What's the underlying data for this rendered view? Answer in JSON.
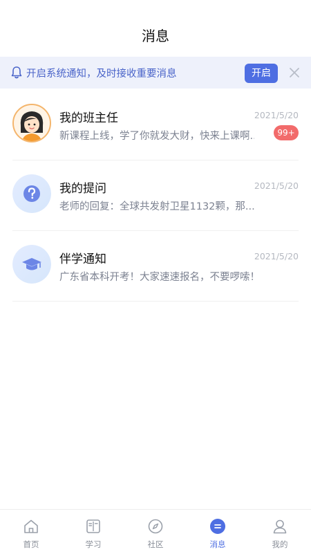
{
  "header": {
    "title": "消息"
  },
  "notice": {
    "text": "开启系统通知，及时接收重要消息",
    "button_label": "开启"
  },
  "messages": [
    {
      "name": "我的班主任",
      "date": "2021/5/20",
      "preview": "新课程上线，学了你就发大财，快来上课啊..",
      "badge": "99+",
      "avatar": "teacher-avatar"
    },
    {
      "name": "我的提问",
      "date": "2021/5/20",
      "preview": "老师的回复：全球共发射卫星1132颗，那...",
      "avatar": "question-icon"
    },
    {
      "name": "伴学通知",
      "date": "2021/5/20",
      "preview": "广东省本科开考！大家速速报名，不要啰嗦！",
      "avatar": "graduation-cap-icon"
    }
  ],
  "tabbar": {
    "items": [
      {
        "label": "首页",
        "icon": "home-icon"
      },
      {
        "label": "学习",
        "icon": "book-icon"
      },
      {
        "label": "社区",
        "icon": "compass-icon"
      },
      {
        "label": "消息",
        "icon": "message-icon",
        "active": true
      },
      {
        "label": "我的",
        "icon": "user-icon"
      }
    ]
  },
  "colors": {
    "accent": "#4e6ee2",
    "badge": "#f26b6b",
    "notice_bg": "#eef1fb"
  }
}
